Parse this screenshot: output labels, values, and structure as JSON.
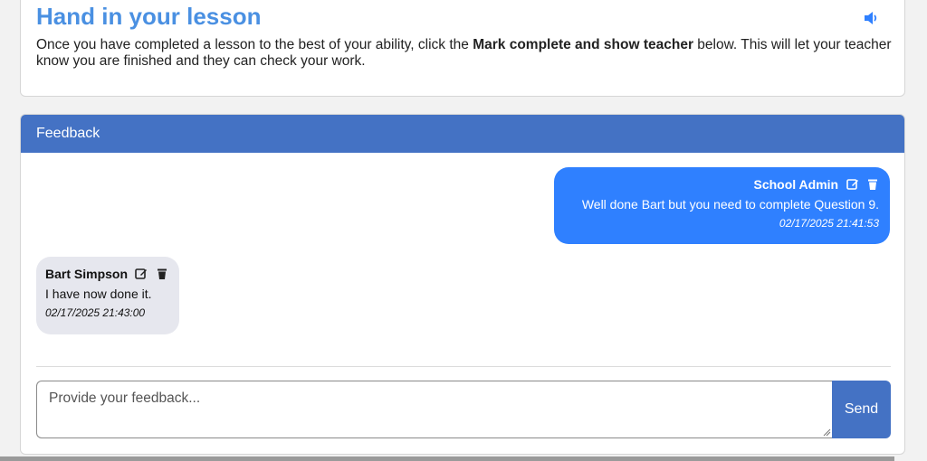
{
  "lesson": {
    "title": "Hand in your lesson",
    "intro_prefix": "Once you have completed a lesson to the best of your ability, click the ",
    "intro_bold": "Mark complete and show teacher",
    "intro_suffix": " below. This will let your teacher know you are finished and they can check your work.",
    "audio_icon": "speaker-icon"
  },
  "feedback": {
    "header": "Feedback",
    "messages": [
      {
        "author": "School Admin",
        "body": "Well done Bart but you need to complete Question 9.",
        "timestamp": "02/17/2025 21:41:53",
        "bubble_color": "#2f80ff",
        "icons": [
          "edit-icon",
          "trash-icon"
        ]
      },
      {
        "author": "Bart Simpson",
        "body": "I have now done it.",
        "timestamp": "02/17/2025 21:43:00",
        "bubble_color": "#e6e7ee",
        "icons": [
          "edit-icon",
          "trash-icon"
        ]
      }
    ],
    "input_placeholder": "Provide your feedback...",
    "send_label": "Send"
  },
  "colors": {
    "accent": "#4472c4",
    "title": "#4a90e2"
  }
}
